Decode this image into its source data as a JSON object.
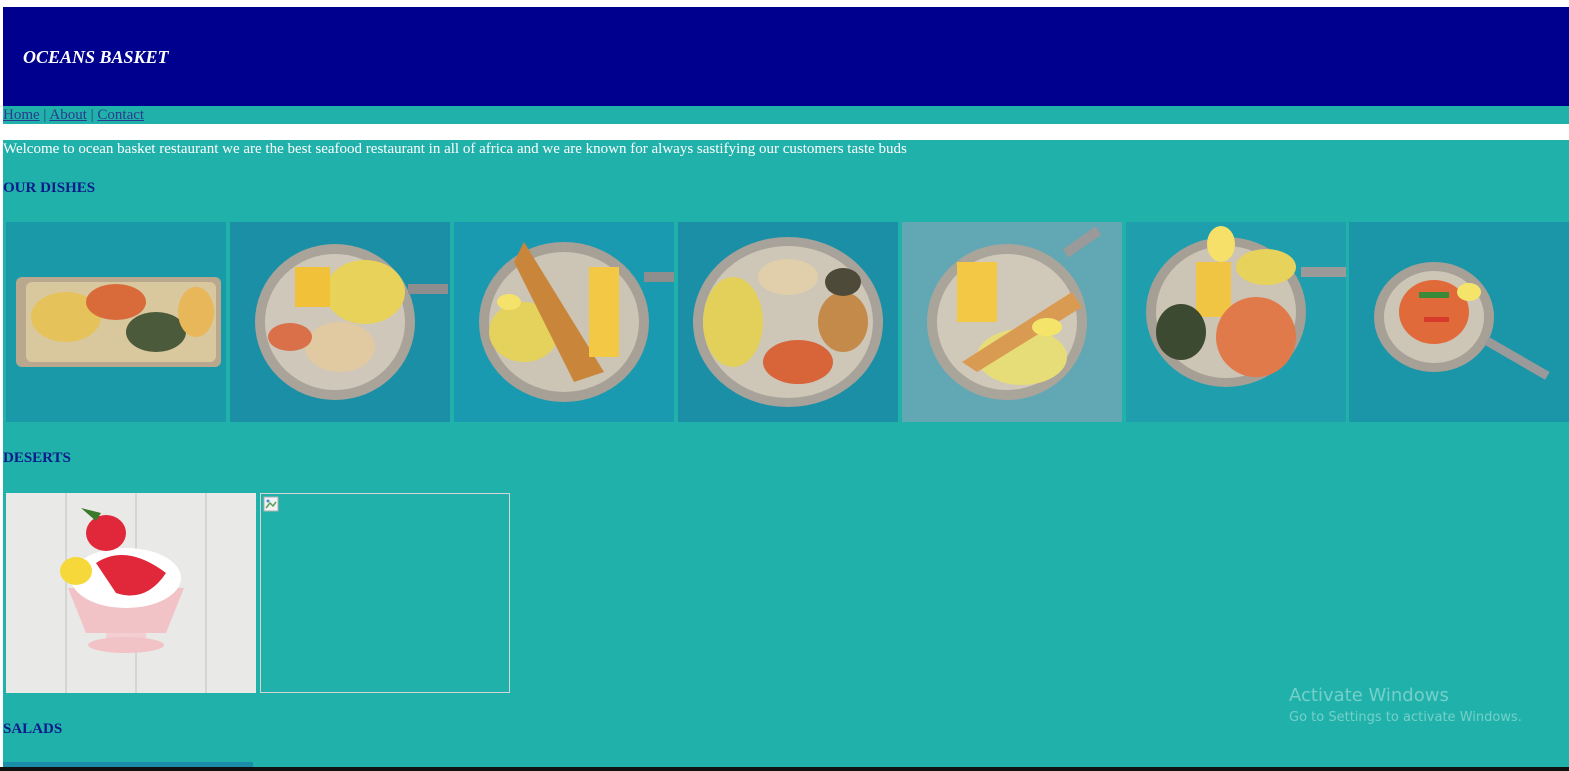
{
  "header": {
    "title": "OCEANS BASKET"
  },
  "nav": {
    "home": "Home",
    "about": "About",
    "contact": "Contact",
    "separator": "|"
  },
  "main": {
    "welcome": "Welcome to ocean basket restaurant we are the best seafood restaurant in all of africa and we are known for always sastifying our customers taste buds",
    "sections": {
      "dishes": "OUR DISHES",
      "deserts": "DESERTS",
      "salads": "SALADS"
    }
  },
  "watermark": {
    "line1": "Activate Windows",
    "line2": "Go to Settings to activate Windows."
  },
  "colors": {
    "header_bg": "#00008e",
    "page_bg": "#20b2aa",
    "heading": "#0a1a8a",
    "link": "#2b3a8c"
  }
}
